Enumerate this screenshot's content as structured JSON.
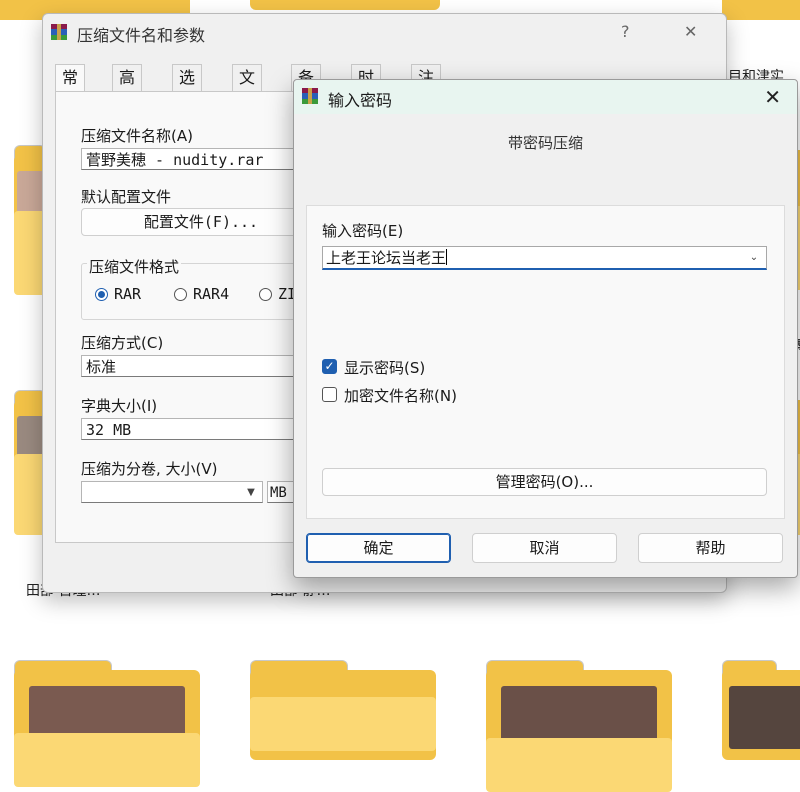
{
  "background": {
    "labels": [
      "田部 吉瞳…",
      "田部 静…",
      "…"
    ],
    "top_right_text": "目和津实",
    "mid_right_text": "寨"
  },
  "main_dialog": {
    "title": "压缩文件名和参数",
    "help_glyph": "?",
    "close_glyph": "✕",
    "tabs": [
      {
        "label": "常规",
        "active": true
      },
      {
        "label": "高级"
      },
      {
        "label": "选项"
      },
      {
        "label": "文件"
      },
      {
        "label": "备份"
      },
      {
        "label": "时间"
      },
      {
        "label": "注释"
      }
    ],
    "archive_name_label": "压缩文件名称(A)",
    "archive_name_value": "菅野美穂 - nudity.rar",
    "profile_label": "默认配置文件",
    "profile_button": "配置文件(F)...",
    "format_group_label": "压缩文件格式",
    "formats": [
      {
        "label": "RAR",
        "selected": true
      },
      {
        "label": "RAR4",
        "selected": false
      },
      {
        "label": "ZI",
        "selected": false
      }
    ],
    "method_label": "压缩方式(C)",
    "method_value": "标准",
    "dict_label": "字典大小(I)",
    "dict_value": "32 MB",
    "volume_label": "压缩为分卷, 大小(V)",
    "volume_value": "",
    "volume_unit": "MB"
  },
  "password_dialog": {
    "title": "输入密码",
    "close_glyph": "✕",
    "subtitle": "带密码压缩",
    "password_label": "输入密码(E)",
    "password_value": "上老王论坛当老王",
    "show_password_label": "显示密码(S)",
    "show_password_checked": true,
    "encrypt_names_label": "加密文件名称(N)",
    "encrypt_names_checked": false,
    "manage_button": "管理密码(O)...",
    "ok_button": "确定",
    "cancel_button": "取消",
    "help_button": "帮助"
  }
}
